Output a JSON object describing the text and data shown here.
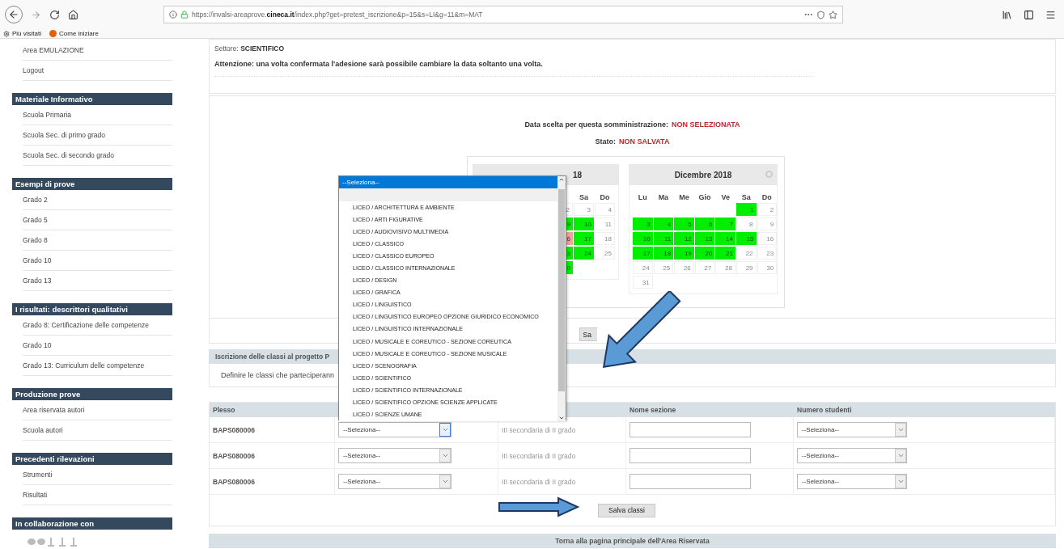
{
  "browser": {
    "url": "https://invalsi-areaprove.**cineca.it**/index.php?get=pretest_iscrizione&p=15&s=LI&g=11&m=MAT",
    "bookmarks": [
      "Più visitati",
      "Come iniziare"
    ]
  },
  "sidebar": {
    "top_items": [
      "Area EMULAZIONE",
      "Logout"
    ],
    "sections": [
      {
        "title": "Materiale Informativo",
        "items": [
          "Scuola Primaria",
          "Scuola Sec. di primo grado",
          "Scuola Sec. di secondo grado"
        ]
      },
      {
        "title": "Esempi di prove",
        "items": [
          "Grado 2",
          "Grado 5",
          "Grado 8",
          "Grado 10",
          "Grado 13"
        ]
      },
      {
        "title": "I risultati: descrittori qualitativi",
        "items": [
          "Grado 8: Certificazione delle competenze",
          "Grado 10",
          "Grado 13: Curriculum delle competenze"
        ]
      },
      {
        "title": "Produzione prove",
        "items": [
          "Area riservata autori",
          "Scuola autori"
        ]
      },
      {
        "title": "Precedenti rilevazioni",
        "items": [
          "Strumenti",
          "Risultati"
        ]
      },
      {
        "title": "In collaborazione con"
      }
    ]
  },
  "settore": {
    "label": "Settore:",
    "value": "SCIENTIFICO"
  },
  "notice": "Attenzione: una volta confermata l'adesione sarà possibile cambiare la data soltanto una volta.",
  "date_choice": {
    "label": "Data scelta per questa somministrazione:",
    "value": "NON SELEZIONATA"
  },
  "status": {
    "label": "Stato:",
    "value": "NON SALVATA"
  },
  "calendar_left": {
    "title": "18",
    "weekdays": [
      "Sa",
      "Do"
    ],
    "weeks": [
      [
        {
          "day": "2",
          "kind": "off"
        },
        {
          "day": "3",
          "kind": "off"
        },
        {
          "day": "4",
          "kind": "off"
        }
      ],
      [
        {
          "day": "9",
          "kind": "available"
        },
        {
          "day": "10",
          "kind": "available"
        },
        {
          "day": "11",
          "kind": "off"
        }
      ],
      [
        {
          "day": "6",
          "kind": "booked"
        },
        {
          "day": "17",
          "kind": "available"
        },
        {
          "day": "18",
          "kind": "off"
        }
      ],
      [
        {
          "day": "3",
          "kind": "available"
        },
        {
          "day": "24",
          "kind": "available"
        },
        {
          "day": "25",
          "kind": "off"
        }
      ],
      [
        {
          "day": "0",
          "kind": "available"
        },
        {
          "kind": "empty"
        },
        {
          "kind": "empty"
        }
      ]
    ]
  },
  "calendar_right": {
    "title": "Dicembre 2018",
    "weekdays": [
      "Lu",
      "Ma",
      "Me",
      "Gio",
      "Ve",
      "Sa",
      "Do"
    ],
    "weeks": [
      [
        {
          "kind": "empty"
        },
        {
          "kind": "empty"
        },
        {
          "kind": "empty"
        },
        {
          "kind": "empty"
        },
        {
          "kind": "empty"
        },
        {
          "day": "1",
          "kind": "available"
        },
        {
          "day": "2",
          "kind": "off"
        }
      ],
      [
        {
          "day": "3",
          "kind": "available"
        },
        {
          "day": "4",
          "kind": "available"
        },
        {
          "day": "5",
          "kind": "available"
        },
        {
          "day": "6",
          "kind": "available"
        },
        {
          "day": "7",
          "kind": "available"
        },
        {
          "day": "8",
          "kind": "off"
        },
        {
          "day": "9",
          "kind": "off"
        }
      ],
      [
        {
          "day": "10",
          "kind": "available"
        },
        {
          "day": "11",
          "kind": "available"
        },
        {
          "day": "12",
          "kind": "available"
        },
        {
          "day": "13",
          "kind": "available"
        },
        {
          "day": "14",
          "kind": "available"
        },
        {
          "day": "15",
          "kind": "available"
        },
        {
          "day": "16",
          "kind": "off"
        }
      ],
      [
        {
          "day": "17",
          "kind": "available"
        },
        {
          "day": "18",
          "kind": "available"
        },
        {
          "day": "19",
          "kind": "available"
        },
        {
          "day": "20",
          "kind": "available"
        },
        {
          "day": "21",
          "kind": "available"
        },
        {
          "day": "22",
          "kind": "off"
        },
        {
          "day": "23",
          "kind": "off"
        }
      ],
      [
        {
          "day": "24",
          "kind": "off"
        },
        {
          "day": "25",
          "kind": "off"
        },
        {
          "day": "26",
          "kind": "off"
        },
        {
          "day": "27",
          "kind": "off"
        },
        {
          "day": "28",
          "kind": "off"
        },
        {
          "day": "29",
          "kind": "off"
        },
        {
          "day": "30",
          "kind": "off"
        }
      ],
      [
        {
          "day": "31",
          "kind": "off"
        },
        {
          "kind": "empty"
        },
        {
          "kind": "empty"
        },
        {
          "kind": "empty"
        },
        {
          "kind": "empty"
        },
        {
          "kind": "empty"
        },
        {
          "kind": "empty"
        }
      ]
    ]
  },
  "save_date_button": "Sa",
  "classes": {
    "title": "Iscrizione delle classi al progetto P",
    "description": "Definire le classi che parteciperann",
    "columns": [
      {
        "kind": "text",
        "label": "Plesso"
      },
      {
        "kind": "hidden"
      },
      {
        "kind": "hidden"
      },
      {
        "kind": "text",
        "label": "Nome sezione"
      },
      {
        "kind": "text",
        "label": "Numero studenti"
      }
    ],
    "rows": [
      {
        "plesso": "BAPS080006",
        "indirizzo": "--Seleziona--",
        "focused": true,
        "classe": "III secondaria di II grado",
        "studenti": "--Seleziona--"
      },
      {
        "plesso": "BAPS080006",
        "indirizzo": "--Seleziona--",
        "focused": false,
        "classe": "III secondaria di II grado",
        "studenti": "--Seleziona--"
      },
      {
        "plesso": "BAPS080006",
        "indirizzo": "--Seleziona--",
        "focused": false,
        "classe": "III secondaria di II grado",
        "studenti": "--Seleziona--"
      }
    ],
    "save_button": "Salva classi"
  },
  "dropdown": {
    "current": "--Seleziona--",
    "highlighted": true,
    "options": [
      "LICEO / ARCHITETTURA E AMBIENTE",
      "LICEO / ARTI FIGURATIVE",
      "LICEO / AUDIOVISIVO MULTIMEDIA",
      "LICEO / CLASSICO",
      "LICEO / CLASSICO EUROPEO",
      "LICEO / CLASSICO INTERNAZIONALE",
      "LICEO / DESIGN",
      "LICEO / GRAFICA",
      "LICEO / LINGUISTICO",
      "LICEO / LINGUISTICO EUROPEO OPZIONE GIURIDICO ECONOMICO",
      "LICEO / LINGUISTICO INTERNAZIONALE",
      "LICEO / MUSICALE E COREUTICO - SEZIONE COREUTICA",
      "LICEO / MUSICALE E COREUTICO - SEZIONE MUSICALE",
      "LICEO / SCENOGRAFIA",
      "LICEO / SCIENTIFICO",
      "LICEO / SCIENTIFICO INTERNAZIONALE",
      "LICEO / SCIENTIFICO OPZIONE SCIENZE APPLICATE",
      "LICEO / SCIENZE UMANE"
    ]
  },
  "footer_link": "Torna alla pagina principale dell'Area Riservata"
}
